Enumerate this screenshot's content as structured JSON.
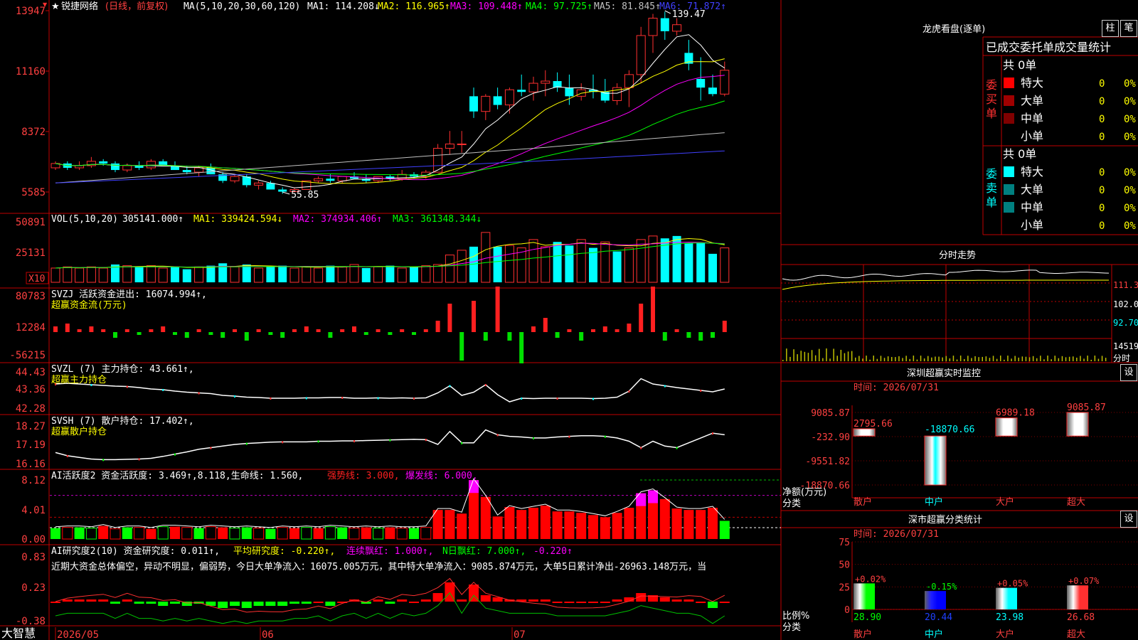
{
  "brand": "大智慧",
  "stock": {
    "name": "锐捷网络",
    "mode": "(日线，前复权)"
  },
  "ma_legend": {
    "label": "MA(5,10,20,30,60,120)",
    "items": [
      {
        "text": "MA1: 114.208↓",
        "color": "#ffffff"
      },
      {
        "text": "MA2: 116.965↑",
        "color": "#ffff00"
      },
      {
        "text": "MA3: 109.448↑",
        "color": "#ff00ff"
      },
      {
        "text": "MA4: 97.725↑",
        "color": "#00ff00"
      },
      {
        "text": "MA5: 81.845↑",
        "color": "#c0c0c0"
      },
      {
        "text": "MA6: 71.872↑",
        "color": "#4040ff"
      }
    ]
  },
  "colors": {
    "up": "#ff3030",
    "down": "#00ffff",
    "axis": "#c00000",
    "label": "#ff4040"
  },
  "price_axis": [
    "13947",
    "11160",
    "8372",
    "5585"
  ],
  "price_high_label": "139.47",
  "price_low_label": "55.85",
  "vol_legend": {
    "label": "VOL(5,10,20)",
    "value": "305141.000↑",
    "items": [
      {
        "text": "MA1: 339424.594↓",
        "color": "#ffff00"
      },
      {
        "text": "MA2: 374934.406↑",
        "color": "#ff00ff"
      },
      {
        "text": "MA3: 361348.344↓",
        "color": "#00ff00"
      }
    ]
  },
  "vol_axis": [
    "50891",
    "25131"
  ],
  "vol_unit": "X10",
  "svzj": {
    "title": "SVZJ  活跃资金进出: 16074.994↑,",
    "subtitle": "超赢资金流(万元)",
    "axis": [
      "80783",
      "12284",
      "-56215"
    ]
  },
  "svzl": {
    "title": "SVZL (7) 主力持仓: 43.661↑,",
    "subtitle": "超赢主力持仓",
    "axis": [
      "44.43",
      "43.36",
      "42.28"
    ]
  },
  "svsh": {
    "title": "SVSH (7) 散户持仓: 17.402↑,",
    "subtitle": "超赢散户持仓",
    "axis": [
      "18.27",
      "17.19",
      "16.16"
    ]
  },
  "ai1": {
    "title": "AI活跃度2 资金活跃度: 3.469↑,8.118,生命线: 1.560,",
    "strong": "强势线: 3.000,",
    "burst": "爆发线: 6.000,",
    "axis": [
      "8.12",
      "4.01",
      "0.00"
    ]
  },
  "ai2": {
    "title": "AI研究度2(10) 资金研究度: 0.011↑,",
    "avg": "平均研究度: -0.220↑,",
    "streak": "连续飘红: 1.000↑,",
    "nday": "N日飘红: 7.000↑,",
    "tail": "-0.220↑",
    "comment": "近期大资金总体偏空，异动不明显，偏弱势，今日大单净流入：16075.005万元，其中特大单净流入：9085.874万元，大单5日累计净出-26963.148万元，当",
    "axis": [
      "0.83",
      "0.23",
      "-0.38"
    ]
  },
  "dates": [
    "2026/05",
    "06",
    "07"
  ],
  "right": {
    "lhb_title": "龙虎看盘(逐单)",
    "btn_bar": "柱",
    "btn_pen": "笔",
    "order_header": "已成交委托单成交量统计",
    "buy_label": "委买单",
    "sell_label": "委卖单",
    "buy_total": "共 0单",
    "sell_total": "共 0单",
    "rows": [
      {
        "name": "特大",
        "count": "0",
        "pct": "0%"
      },
      {
        "name": "大单",
        "count": "0",
        "pct": "0%"
      },
      {
        "name": "中单",
        "count": "0",
        "pct": "0%"
      },
      {
        "name": "小单",
        "count": "0",
        "pct": "0%"
      }
    ],
    "intraday_title": "分时走势",
    "intraday_axis": [
      "111.3",
      "102.0",
      "92.70",
      "14519",
      "分时"
    ],
    "sz_monitor_title": "深圳超赢实时监控",
    "sz_time": "时间: 2026/07/31",
    "sz_axis": [
      "9085.87",
      "-232.90",
      "-9551.82",
      "-18870.66"
    ],
    "sz_ylabel": "净额(万元)",
    "sz_xlabel": "分类",
    "btn_set": "设",
    "categories": [
      "散户",
      "中户",
      "大户",
      "超大"
    ],
    "sz_values": [
      2795.66,
      -18870.66,
      6989.18,
      9085.87
    ],
    "sz_value_labels": [
      "2795.66",
      "-18870.66",
      "6989.18",
      "9085.87"
    ],
    "sh_title": "深市超赢分类统计",
    "sh_time": "时间: 2026/07/31",
    "sh_axis": [
      "75",
      "50",
      "25",
      "0"
    ],
    "sh_ylabel": "比例%",
    "sh_xlabel": "分类",
    "sh_values": [
      28.9,
      20.44,
      23.98,
      26.68
    ],
    "sh_value_labels": [
      "28.90",
      "20.44",
      "23.98",
      "26.68"
    ],
    "sh_change_labels": [
      "+0.02%",
      "-0.15%",
      "+0.05%",
      "+0.07%"
    ]
  },
  "chart_data": {
    "type": "candlestick",
    "series_ohlc": [
      [
        67,
        70,
        66,
        69
      ],
      [
        69,
        70,
        66,
        67
      ],
      [
        67,
        70,
        66,
        68
      ],
      [
        68,
        72,
        67,
        70
      ],
      [
        70,
        71,
        68,
        69
      ],
      [
        69,
        70,
        65,
        66
      ],
      [
        66,
        69,
        65,
        68
      ],
      [
        68,
        70,
        66,
        67
      ],
      [
        67,
        71,
        66,
        70
      ],
      [
        70,
        71,
        68,
        68
      ],
      [
        68,
        70,
        66,
        66
      ],
      [
        66,
        68,
        64,
        65
      ],
      [
        65,
        68,
        63,
        67
      ],
      [
        67,
        69,
        64,
        64
      ],
      [
        64,
        65,
        60,
        61
      ],
      [
        61,
        64,
        60,
        63
      ],
      [
        63,
        64,
        58,
        59
      ],
      [
        59,
        61,
        57,
        60
      ],
      [
        60,
        61,
        57,
        57
      ],
      [
        57,
        58,
        55,
        56
      ],
      [
        56,
        58,
        56,
        57
      ],
      [
        57,
        61,
        57,
        61
      ],
      [
        61,
        63,
        60,
        62
      ],
      [
        62,
        64,
        60,
        61
      ],
      [
        61,
        63,
        60,
        63
      ],
      [
        63,
        65,
        62,
        62
      ],
      [
        62,
        64,
        60,
        61
      ],
      [
        61,
        63,
        60,
        63
      ],
      [
        63,
        64,
        61,
        62
      ],
      [
        62,
        66,
        61,
        64
      ],
      [
        64,
        65,
        62,
        63
      ],
      [
        63,
        66,
        62,
        65
      ],
      [
        65,
        78,
        65,
        76
      ],
      [
        76,
        84,
        73,
        78
      ],
      [
        78,
        84,
        74,
        78
      ],
      [
        100,
        104,
        90,
        93
      ],
      [
        93,
        101,
        89,
        100
      ],
      [
        100,
        104,
        94,
        96
      ],
      [
        96,
        104,
        92,
        103
      ],
      [
        103,
        110,
        100,
        102
      ],
      [
        102,
        109,
        98,
        106
      ],
      [
        106,
        112,
        100,
        107
      ],
      [
        107,
        111,
        102,
        104
      ],
      [
        104,
        110,
        96,
        100
      ],
      [
        100,
        106,
        98,
        103
      ],
      [
        103,
        110,
        99,
        102
      ],
      [
        102,
        108,
        97,
        98
      ],
      [
        98,
        106,
        96,
        104
      ],
      [
        104,
        112,
        95,
        110
      ],
      [
        110,
        132,
        106,
        128
      ],
      [
        128,
        138,
        120,
        136
      ],
      [
        136,
        139,
        126,
        130
      ],
      [
        130,
        136,
        128,
        133
      ],
      [
        120,
        126,
        112,
        115
      ],
      [
        108,
        118,
        98,
        104
      ],
      [
        104,
        110,
        100,
        101
      ],
      [
        101,
        116,
        100,
        112
      ]
    ],
    "volume": [
      12,
      13,
      12,
      13,
      12,
      15,
      14,
      13,
      14,
      12,
      13,
      11,
      13,
      14,
      16,
      13,
      15,
      12,
      13,
      14,
      12,
      13,
      12,
      14,
      13,
      15,
      12,
      13,
      14,
      12,
      13,
      14,
      15,
      23,
      27,
      30,
      42,
      30,
      31,
      29,
      36,
      30,
      34,
      31,
      36,
      29,
      34,
      26,
      29,
      36,
      39,
      37,
      39,
      33,
      33,
      24,
      29
    ],
    "vol_up": [
      true,
      true,
      true,
      true,
      true,
      false,
      true,
      false,
      true,
      true,
      false,
      false,
      true,
      false,
      false,
      true,
      false,
      true,
      false,
      false,
      true,
      true,
      true,
      false,
      true,
      true,
      false,
      true,
      false,
      true,
      false,
      true,
      true,
      true,
      true,
      false,
      true,
      false,
      true,
      true,
      true,
      true,
      false,
      false,
      true,
      false,
      true,
      false,
      true,
      true,
      true,
      false,
      false,
      false,
      false,
      false,
      true
    ],
    "flow": [
      0.2,
      0.3,
      0.1,
      0.2,
      0.1,
      -0.2,
      0.1,
      -0.1,
      0.1,
      0.2,
      -0.1,
      -0.2,
      0.1,
      -0.1,
      -0.2,
      0.1,
      -0.3,
      0.1,
      -0.1,
      -0.2,
      0.1,
      0.2,
      0.1,
      -0.2,
      0.1,
      0.2,
      -0.1,
      0.1,
      -0.1,
      0.1,
      -0.1,
      0.1,
      0.4,
      1.0,
      -1.0,
      1.1,
      -0.3,
      1.6,
      -0.3,
      -1.1,
      0.2,
      0.5,
      -0.2,
      0.1,
      -0.3,
      0.1,
      0.2,
      0.1,
      0.3,
      1.0,
      1.6,
      -0.3,
      0.1,
      -0.2,
      -0.3,
      -0.2,
      0.4
    ],
    "zl": [
      43.7,
      43.72,
      43.7,
      43.68,
      43.66,
      43.64,
      43.63,
      43.6,
      43.56,
      43.54,
      43.5,
      43.47,
      43.45,
      43.43,
      43.38,
      43.36,
      43.33,
      43.32,
      43.3,
      43.3,
      43.3,
      43.31,
      43.31,
      43.32,
      43.32,
      43.3,
      43.3,
      43.31,
      43.3,
      43.31,
      43.3,
      43.31,
      43.45,
      43.65,
      43.38,
      43.47,
      43.68,
      43.4,
      43.2,
      43.3,
      43.29,
      43.3,
      43.3,
      43.3,
      43.3,
      43.29,
      43.3,
      43.33,
      43.5,
      43.85,
      43.7,
      43.65,
      43.6,
      43.56,
      43.52,
      43.48,
      43.56
    ],
    "sh": [
      16.6,
      16.5,
      16.45,
      16.4,
      16.38,
      16.38,
      16.39,
      16.4,
      16.42,
      16.48,
      16.55,
      16.62,
      16.7,
      16.75,
      16.8,
      16.85,
      16.88,
      16.9,
      16.92,
      16.93,
      16.93,
      16.93,
      16.95,
      16.95,
      16.96,
      16.96,
      16.97,
      16.98,
      16.99,
      17.0,
      17.01,
      17.0,
      16.85,
      17.25,
      16.9,
      16.9,
      17.3,
      17.15,
      17.1,
      17.08,
      17.05,
      17.05,
      17.08,
      17.1,
      17.12,
      17.12,
      17.1,
      17.05,
      16.95,
      16.75,
      16.95,
      16.8,
      16.75,
      16.9,
      17.05,
      17.2,
      17.15
    ],
    "ai_act": [
      1.5,
      1.6,
      1.6,
      1.5,
      1.8,
      1.4,
      1.6,
      1.6,
      1.4,
      1.7,
      1.7,
      1.6,
      1.5,
      1.7,
      1.6,
      1.5,
      1.6,
      1.5,
      1.4,
      1.6,
      1.5,
      1.6,
      1.5,
      1.7,
      1.6,
      1.5,
      1.6,
      1.5,
      1.6,
      1.5,
      1.5,
      1.6,
      4.0,
      4.0,
      3.5,
      8.1,
      5.8,
      3.1,
      4.4,
      4.0,
      4.3,
      4.6,
      3.8,
      3.8,
      3.6,
      3.3,
      3.0,
      3.6,
      4.3,
      6.3,
      6.7,
      5.5,
      4.2,
      4.0,
      4.0,
      4.3,
      2.5,
      3.5
    ],
    "ai_res": [
      0.0,
      0.05,
      0.05,
      0.05,
      0.05,
      -0.05,
      0.05,
      -0.05,
      -0.05,
      -0.1,
      -0.05,
      -0.1,
      -0.05,
      -0.1,
      -0.15,
      -0.1,
      -0.15,
      -0.1,
      -0.1,
      -0.1,
      -0.05,
      -0.05,
      0.0,
      -0.1,
      0.0,
      0.05,
      -0.05,
      0.05,
      -0.05,
      0.05,
      0.0,
      0.05,
      0.2,
      0.45,
      0.05,
      0.4,
      0.15,
      0.1,
      0.05,
      0.05,
      0.05,
      0.05,
      0.0,
      0.0,
      0.0,
      0.0,
      0.0,
      0.05,
      0.1,
      0.2,
      0.15,
      0.1,
      0.05,
      0.05,
      0.0,
      -0.15,
      0.0
    ]
  }
}
